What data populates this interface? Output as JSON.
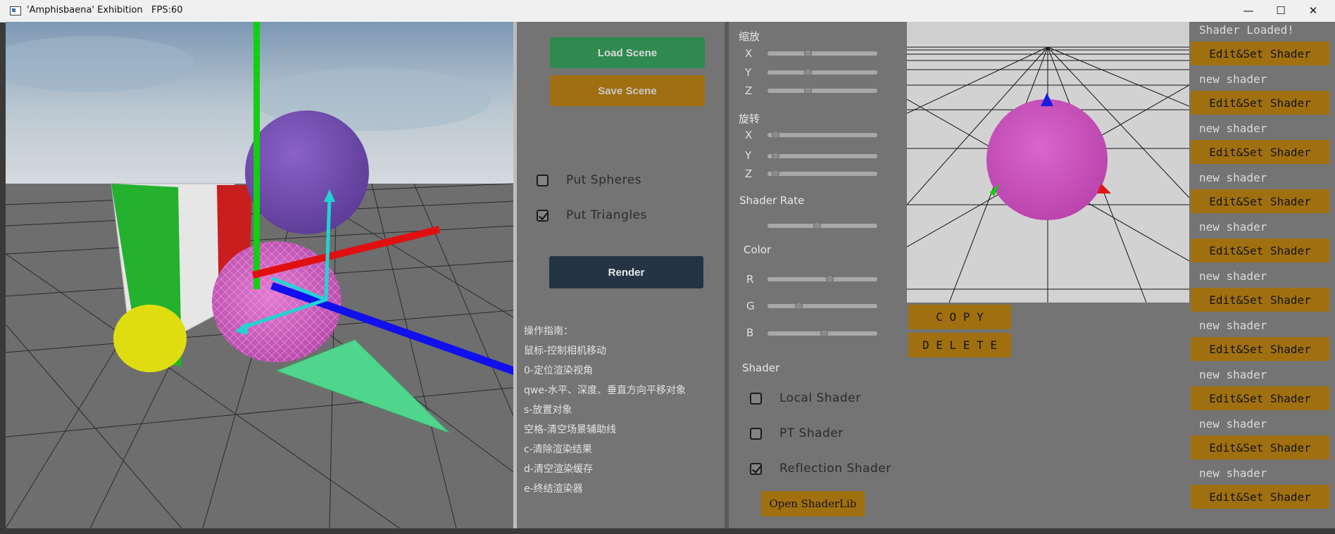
{
  "window": {
    "title": "'Amphisbaena' Exhibition   FPS:60",
    "minimize": "—",
    "maximize": "☐",
    "close": "✕"
  },
  "controls": {
    "load_scene": "Load Scene",
    "save_scene": "Save Scene",
    "put_spheres": "Put Spheres",
    "put_spheres_checked": false,
    "put_triangles": "Put Triangles",
    "put_triangles_checked": true,
    "render": "Render"
  },
  "guide": {
    "title": "操作指南：",
    "lines": [
      "鼠标-控制相机移动",
      "0-定位渲染视角",
      "qwe-水平、深度、垂直方向平移对象",
      "s-放置对象",
      "空格-清空场景辅助线",
      "c-清除渲染结果",
      "d-清空渲染缓存",
      "e-终结渲染器"
    ]
  },
  "transform": {
    "scale_label": "缩放",
    "scale": [
      {
        "axis": "X",
        "value": 0.36
      },
      {
        "axis": "Y",
        "value": 0.36
      },
      {
        "axis": "Z",
        "value": 0.36
      }
    ],
    "rotate_label": "旋转",
    "rotate": [
      {
        "axis": "X",
        "value": 0.04
      },
      {
        "axis": "Y",
        "value": 0.04
      },
      {
        "axis": "Z",
        "value": 0.04
      }
    ],
    "shader_rate_label": "Shader Rate",
    "shader_rate": 0.45,
    "color_label": "Color",
    "color": [
      {
        "axis": "R",
        "value": 0.57
      },
      {
        "axis": "G",
        "value": 0.27
      },
      {
        "axis": "B",
        "value": 0.52
      }
    ]
  },
  "shader": {
    "label": "Shader",
    "local": "Local Shader",
    "local_checked": false,
    "pt": "PT Shader",
    "pt_checked": false,
    "reflection": "Reflection Shader",
    "reflection_checked": true,
    "open_lib": "Open ShaderLib"
  },
  "preview": {
    "copy": "C O P Y",
    "delete": "D E L E T E"
  },
  "shader_list": [
    {
      "name": "Shader Loaded!",
      "button": "Edit&Set Shader"
    },
    {
      "name": "new shader",
      "button": "Edit&Set Shader"
    },
    {
      "name": "new shader",
      "button": "Edit&Set Shader"
    },
    {
      "name": "new shader",
      "button": "Edit&Set Shader"
    },
    {
      "name": "new shader",
      "button": "Edit&Set Shader"
    },
    {
      "name": "new shader",
      "button": "Edit&Set Shader"
    },
    {
      "name": "new shader",
      "button": "Edit&Set Shader"
    },
    {
      "name": "new shader",
      "button": "Edit&Set Shader"
    },
    {
      "name": "new shader",
      "button": "Edit&Set Shader"
    },
    {
      "name": "new shader",
      "button": "Edit&Set Shader"
    }
  ],
  "colors": {
    "panel": "#747474",
    "load": "#2f8a4f",
    "save": "#a06f12",
    "render": "#253444",
    "gold": "#a07010"
  }
}
